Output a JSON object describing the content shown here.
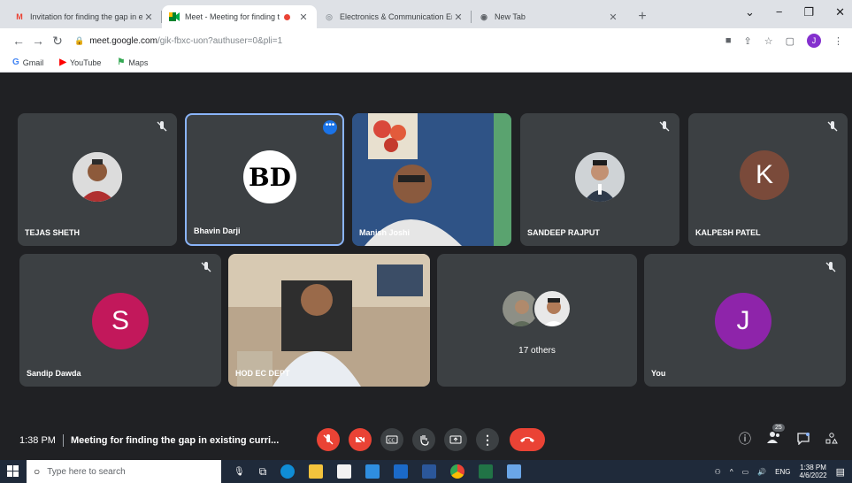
{
  "browser": {
    "tabs": [
      {
        "title": "Invitation for finding the gap in e",
        "favicon": "gmail-icon",
        "active": false
      },
      {
        "title": "Meet - Meeting for finding t",
        "favicon": "meet-icon",
        "active": true,
        "recording": true
      },
      {
        "title": "Electronics & Communication En",
        "favicon": "college-icon",
        "active": false
      },
      {
        "title": "New Tab",
        "favicon": "chrome-icon",
        "active": false
      }
    ],
    "new_tab": "+",
    "url_domain": "meet.google.com",
    "url_path": "/gik-fbxc-uon?authuser=0&pli=1",
    "profile_initial": "J",
    "bookmarks": [
      {
        "label": "Gmail",
        "icon": "G",
        "color": "#4285f4"
      },
      {
        "label": "YouTube",
        "icon": "▶",
        "color": "#ff0000"
      },
      {
        "label": "Maps",
        "icon": "⚑",
        "color": "#34a853"
      }
    ]
  },
  "meet": {
    "participants": [
      {
        "name": "TEJAS SHETH",
        "type": "photo"
      },
      {
        "name": "Bhavin Darji",
        "type": "logo",
        "logo_text": "BD"
      },
      {
        "name": "Manish Joshi",
        "type": "video"
      },
      {
        "name": "SANDEEP RAJPUT",
        "type": "photo"
      },
      {
        "name": "KALPESH PATEL",
        "type": "letter",
        "letter": "K",
        "color": "#7a4a3a"
      },
      {
        "name": "Sandip Dawda",
        "type": "letter",
        "letter": "S",
        "color": "#c2185b"
      },
      {
        "name": "HOD EC DEPT",
        "type": "video"
      },
      {
        "name": "17 others",
        "type": "group"
      },
      {
        "name": "You",
        "type": "letter",
        "letter": "J",
        "color": "#8e24aa"
      }
    ],
    "time": "1:38 PM",
    "meeting_title": "Meeting for finding the gap in existing curri...",
    "participant_count": "25"
  },
  "taskbar": {
    "search_placeholder": "Type here to search",
    "lang": "ENG",
    "time": "1:38 PM",
    "date": "4/6/2022"
  }
}
